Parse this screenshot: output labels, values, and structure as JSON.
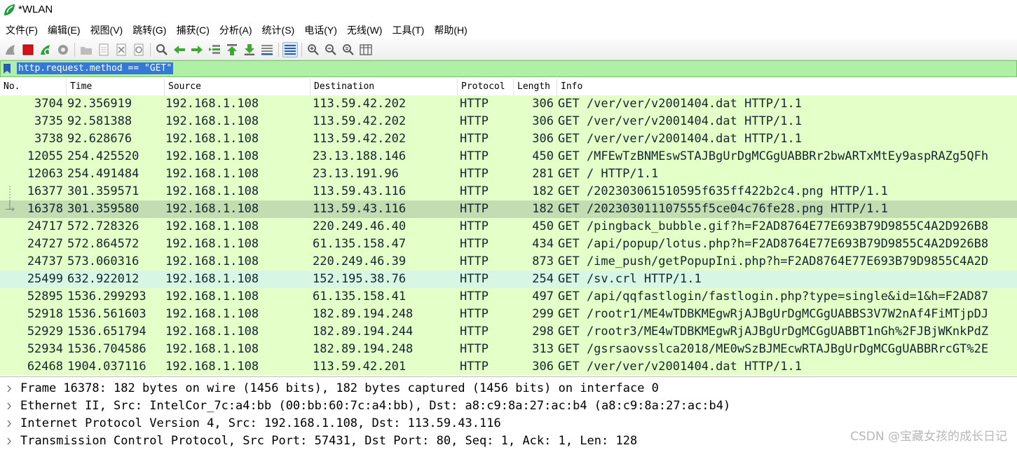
{
  "window": {
    "title": "*WLAN"
  },
  "menu": [
    "文件(F)",
    "编辑(E)",
    "视图(V)",
    "跳转(G)",
    "捕获(C)",
    "分析(A)",
    "统计(S)",
    "电话(Y)",
    "无线(W)",
    "工具(T)",
    "帮助(H)"
  ],
  "toolbar": {
    "buttons": [
      "shark-fin-start-icon",
      "stop-capture-icon",
      "restart-capture-icon",
      "capture-options-icon",
      "open-file-icon",
      "save-file-icon",
      "close-file-icon",
      "reload-file-icon",
      "find-packet-icon",
      "go-back-icon",
      "go-forward-icon",
      "go-to-packet-icon",
      "go-first-icon",
      "go-last-icon",
      "auto-scroll-icon",
      "colorize-icon",
      "zoom-in-icon",
      "zoom-out-icon",
      "zoom-normal-icon",
      "resize-columns-icon"
    ]
  },
  "filter": {
    "value": "http.request.method == \"GET\""
  },
  "columns": [
    "No.",
    "Time",
    "Source",
    "Destination",
    "Protocol",
    "Length",
    "Info"
  ],
  "packets": [
    {
      "no": "3704",
      "time": "92.356919",
      "src": "192.168.1.108",
      "dst": "113.59.42.202",
      "proto": "HTTP",
      "len": "306",
      "info": "GET /ver/ver/v2001404.dat HTTP/1.1"
    },
    {
      "no": "3735",
      "time": "92.581388",
      "src": "192.168.1.108",
      "dst": "113.59.42.202",
      "proto": "HTTP",
      "len": "306",
      "info": "GET /ver/ver/v2001404.dat HTTP/1.1"
    },
    {
      "no": "3738",
      "time": "92.628676",
      "src": "192.168.1.108",
      "dst": "113.59.42.202",
      "proto": "HTTP",
      "len": "306",
      "info": "GET /ver/ver/v2001404.dat HTTP/1.1"
    },
    {
      "no": "12055",
      "time": "254.425520",
      "src": "192.168.1.108",
      "dst": "23.13.188.146",
      "proto": "HTTP",
      "len": "450",
      "info": "GET /MFEwTzBNMEswSTAJBgUrDgMCGgUABBRr2bwARTxMtEy9aspRAZg5QFh"
    },
    {
      "no": "12063",
      "time": "254.491484",
      "src": "192.168.1.108",
      "dst": "23.13.191.96",
      "proto": "HTTP",
      "len": "281",
      "info": "GET / HTTP/1.1"
    },
    {
      "no": "16377",
      "time": "301.359571",
      "src": "192.168.1.108",
      "dst": "113.59.43.116",
      "proto": "HTTP",
      "len": "182",
      "info": "GET /202303061510595f635ff422b2c4.png HTTP/1.1"
    },
    {
      "no": "16378",
      "time": "301.359580",
      "src": "192.168.1.108",
      "dst": "113.59.43.116",
      "proto": "HTTP",
      "len": "182",
      "info": "GET /202303011107555f5ce04c76fe28.png HTTP/1.1"
    },
    {
      "no": "24717",
      "time": "572.728326",
      "src": "192.168.1.108",
      "dst": "220.249.46.40",
      "proto": "HTTP",
      "len": "450",
      "info": "GET /pingback_bubble.gif?h=F2AD8764E77E693B79D9855C4A2D926B8"
    },
    {
      "no": "24727",
      "time": "572.864572",
      "src": "192.168.1.108",
      "dst": "61.135.158.47",
      "proto": "HTTP",
      "len": "434",
      "info": "GET /api/popup/lotus.php?h=F2AD8764E77E693B79D9855C4A2D926B8"
    },
    {
      "no": "24737",
      "time": "573.060316",
      "src": "192.168.1.108",
      "dst": "220.249.46.39",
      "proto": "HTTP",
      "len": "873",
      "info": "GET /ime_push/getPopupIni.php?h=F2AD8764E77E693B79D9855C4A2D"
    },
    {
      "no": "25499",
      "time": "632.922012",
      "src": "192.168.1.108",
      "dst": "152.195.38.76",
      "proto": "HTTP",
      "len": "254",
      "info": "GET /sv.crl HTTP/1.1"
    },
    {
      "no": "52895",
      "time": "1536.299293",
      "src": "192.168.1.108",
      "dst": "61.135.158.41",
      "proto": "HTTP",
      "len": "497",
      "info": "GET /api/qqfastlogin/fastlogin.php?type=single&id=1&h=F2AD87"
    },
    {
      "no": "52918",
      "time": "1536.561603",
      "src": "192.168.1.108",
      "dst": "182.89.194.248",
      "proto": "HTTP",
      "len": "299",
      "info": "GET /rootr1/ME4wTDBKMEgwRjAJBgUrDgMCGgUABBS3V7W2nAf4FiMTjpDJ"
    },
    {
      "no": "52929",
      "time": "1536.651794",
      "src": "192.168.1.108",
      "dst": "182.89.194.244",
      "proto": "HTTP",
      "len": "298",
      "info": "GET /rootr3/ME4wTDBKMEgwRjAJBgUrDgMCGgUABBT1nGh%2FJBjWKnkPdZ"
    },
    {
      "no": "52934",
      "time": "1536.704586",
      "src": "192.168.1.108",
      "dst": "182.89.194.248",
      "proto": "HTTP",
      "len": "313",
      "info": "GET /gsrsaovsslca2018/ME0wSzBJMEcwRTAJBgUrDgMCGgUABBRrcGT%2E"
    },
    {
      "no": "62468",
      "time": "1904.037116",
      "src": "192.168.1.108",
      "dst": "113.59.42.201",
      "proto": "HTTP",
      "len": "306",
      "info": "GET /ver/ver/v2001404.dat HTTP/1.1"
    }
  ],
  "selected_packet": "16378",
  "details": [
    "Frame 16378: 182 bytes on wire (1456 bits), 182 bytes captured (1456 bits) on interface 0",
    "Ethernet II, Src: IntelCor_7c:a4:bb (00:bb:60:7c:a4:bb), Dst: a8:c9:8a:27:ac:b4 (a8:c9:8a:27:ac:b4)",
    "Internet Protocol Version 4, Src: 192.168.1.108, Dst: 113.59.43.116",
    "Transmission Control Protocol, Src Port: 57431, Dst Port: 80, Seq: 1, Ack: 1, Len: 128"
  ],
  "watermark": "CSDN @宝藏女孩的成长日记",
  "colors": {
    "row_bg": "#e4ffc7",
    "row_selected": "#c4dcb2",
    "row_alt": "#d7f6e3",
    "filter_bg": "#aff0a6",
    "filter_highlight": "#3478d8"
  }
}
